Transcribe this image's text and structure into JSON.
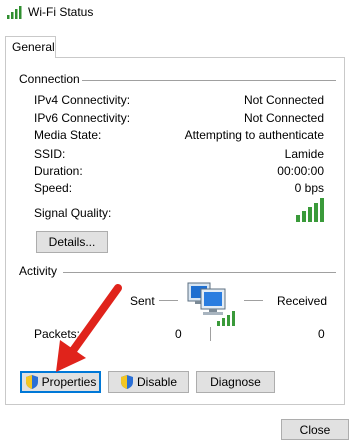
{
  "window": {
    "title": "Wi-Fi Status"
  },
  "tabs": [
    {
      "label": "General"
    }
  ],
  "connection": {
    "section_label": "Connection",
    "rows": [
      {
        "label": "IPv4 Connectivity:",
        "value": "Not Connected"
      },
      {
        "label": "IPv6 Connectivity:",
        "value": "Not Connected"
      },
      {
        "label": "Media State:",
        "value": "Attempting to authenticate"
      },
      {
        "label": "SSID:",
        "value": "Lamide"
      },
      {
        "label": "Duration:",
        "value": "00:00:00"
      },
      {
        "label": "Speed:",
        "value": "0 bps"
      }
    ],
    "signal_label": "Signal Quality:",
    "signal_bars_active": 5,
    "details_button": "Details..."
  },
  "activity": {
    "section_label": "Activity",
    "sent_label": "Sent",
    "received_label": "Received",
    "packets_label": "Packets:",
    "packets_sent": "0",
    "packets_received": "0"
  },
  "buttons": {
    "properties": "Properties",
    "disable": "Disable",
    "diagnose": "Diagnose",
    "close": "Close"
  },
  "colors": {
    "signal_green": "#3a9a3a",
    "focus_blue": "#0078d7",
    "annotation_red": "#e0231b"
  },
  "icons": [
    "wifi-signal-icon",
    "network-computers-icon",
    "uac-shield-icon"
  ]
}
